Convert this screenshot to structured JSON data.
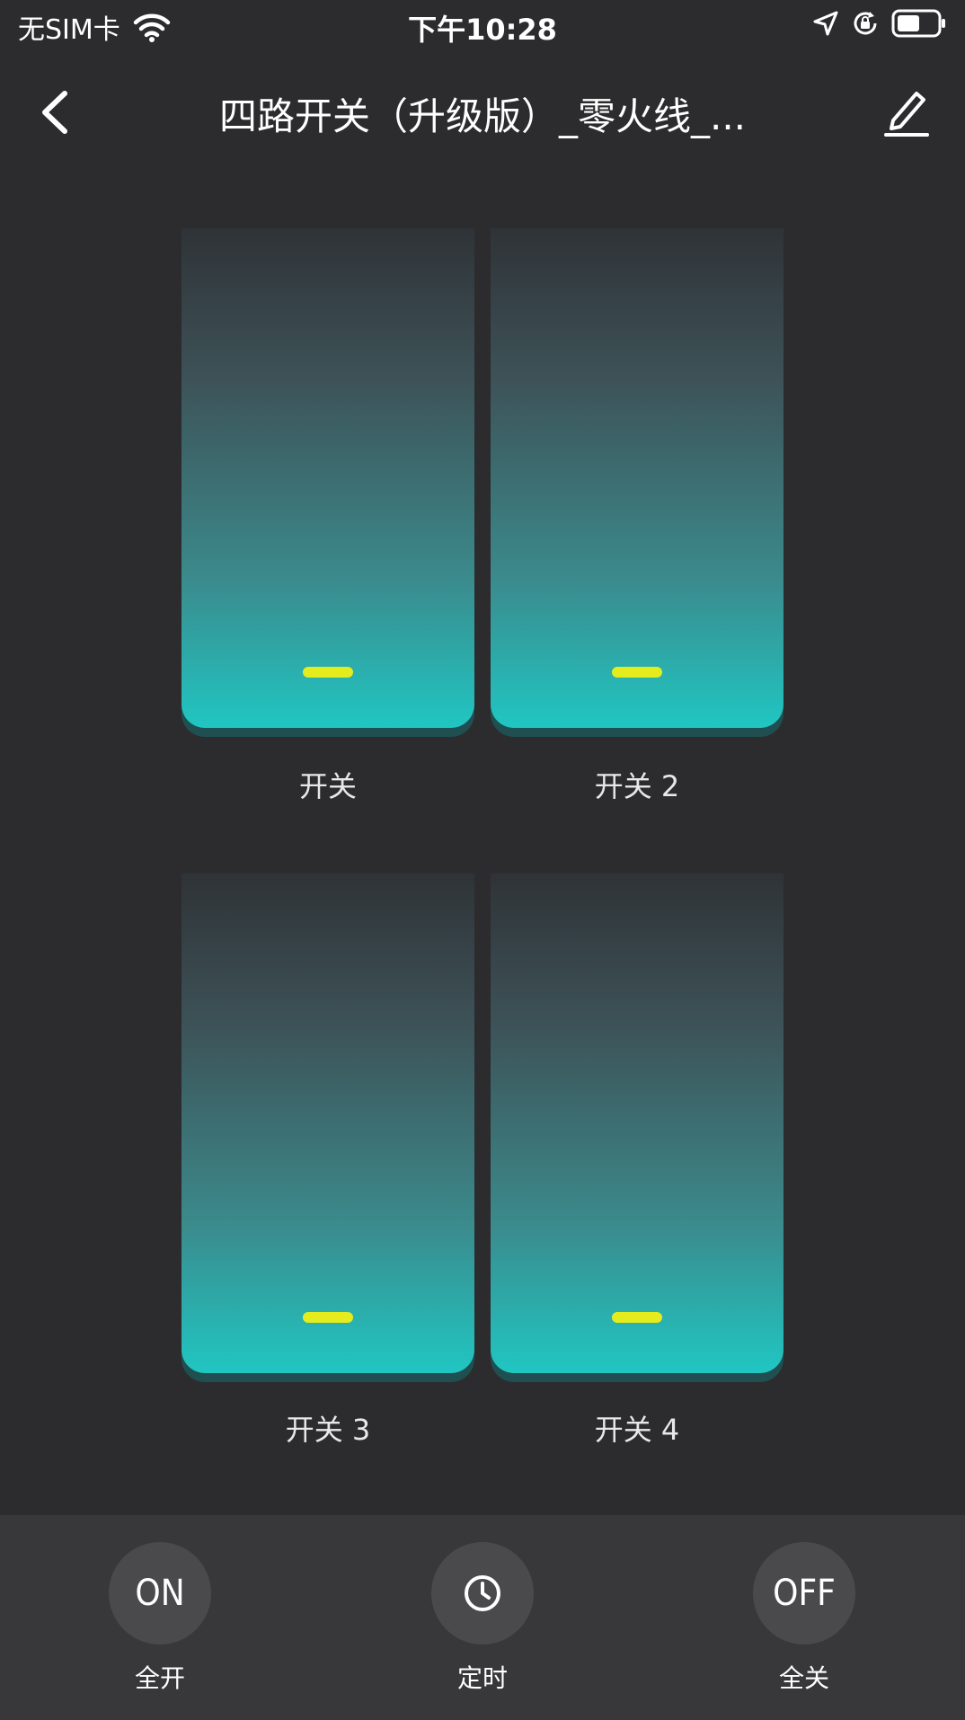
{
  "status_bar": {
    "carrier": "无SIM卡",
    "time": "下午10:28"
  },
  "nav": {
    "title": "四路开关（升级版）_零火线_..."
  },
  "switches": [
    {
      "label": "开关"
    },
    {
      "label": "开关 2"
    },
    {
      "label": "开关 3"
    },
    {
      "label": "开关 4"
    }
  ],
  "actions": {
    "all_on": {
      "icon_text": "ON",
      "label": "全开"
    },
    "timer": {
      "icon": "clock-icon",
      "label": "定时"
    },
    "all_off": {
      "icon_text": "OFF",
      "label": "全关"
    }
  },
  "colors": {
    "background": "#2c2c2e",
    "switch_accent": "#20c6c2",
    "indicator": "#e4ec1e"
  }
}
